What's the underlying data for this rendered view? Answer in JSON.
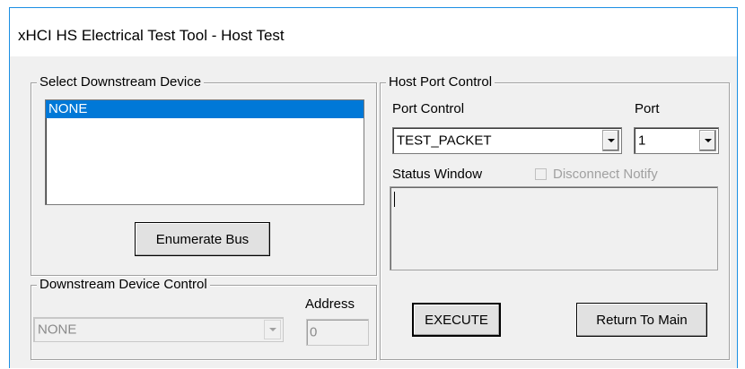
{
  "window": {
    "title": "xHCI HS Electrical Test Tool - Host Test"
  },
  "select_downstream": {
    "legend": "Select Downstream Device",
    "items": [
      "NONE"
    ],
    "enumerate_label": "Enumerate Bus"
  },
  "downstream_control": {
    "legend": "Downstream Device Control",
    "device_value": "NONE",
    "address_label": "Address",
    "address_value": "0"
  },
  "host_port": {
    "legend": "Host Port Control",
    "port_control_label": "Port Control",
    "port_control_value": "TEST_PACKET",
    "port_label": "Port",
    "port_value": "1",
    "status_label": "Status Window",
    "disconnect_label": "Disconnect Notify",
    "execute_label": "EXECUTE",
    "return_label": "Return To Main"
  }
}
